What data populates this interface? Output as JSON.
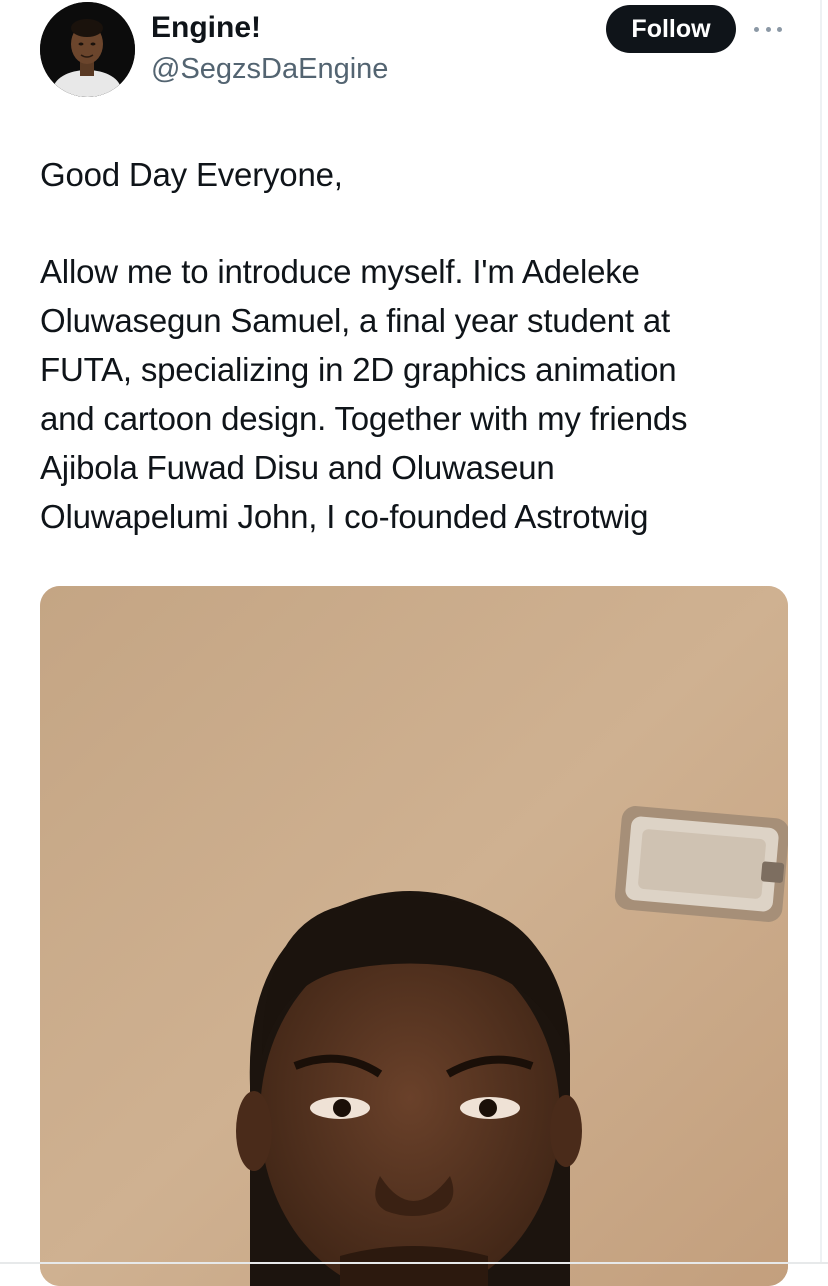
{
  "author": {
    "display_name": "Engine!",
    "handle": "@SegzsDaEngine",
    "avatar_icon": "profile-photo"
  },
  "actions": {
    "follow_label": "Follow",
    "more_icon": "more-horizontal-icon"
  },
  "tweet": {
    "greeting": "Good Day Everyone,",
    "body_lines": [
      "Allow me to introduce myself. I'm Adeleke",
      "Oluwasegun Samuel, a final year student at",
      "FUTA, specializing in 2D graphics animation",
      "and cartoon design. Together with my friends",
      "Ajibola Fuwad Disu and Oluwaseun",
      "Oluwapelumi John, I co-founded Astrotwig"
    ]
  },
  "media": {
    "kind": "photo"
  },
  "colors": {
    "text": "#0f1419",
    "secondary": "#536471",
    "button_bg": "#0f1419",
    "button_text": "#ffffff"
  }
}
